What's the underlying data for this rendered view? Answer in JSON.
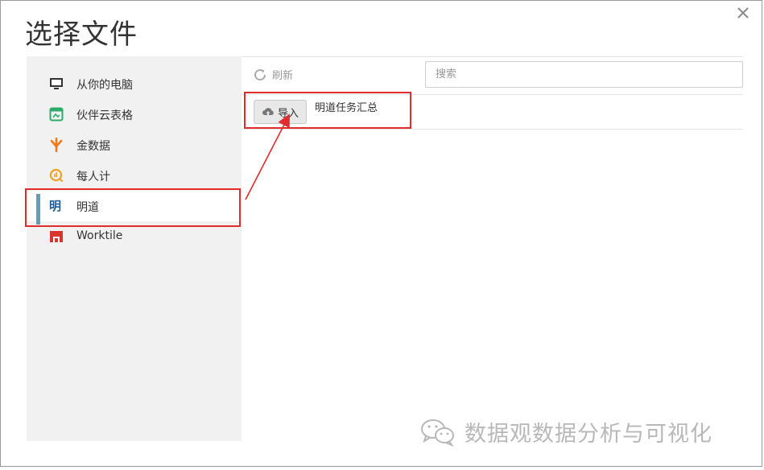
{
  "dialog": {
    "title": "选择文件"
  },
  "sidebar": {
    "items": [
      {
        "label": "从你的电脑",
        "icon": "monitor-icon"
      },
      {
        "label": "伙伴云表格",
        "icon": "spreadsheet-icon"
      },
      {
        "label": "金数据",
        "icon": "tree-logo-icon"
      },
      {
        "label": "每人计",
        "icon": "coin-logo-icon"
      },
      {
        "label": "明道",
        "icon": "mingdao-logo-icon",
        "glyph": "明"
      },
      {
        "label": "Worktile",
        "icon": "worktile-logo-icon"
      }
    ],
    "active_index": 4
  },
  "toolbar": {
    "refresh_label": "刷新",
    "search_placeholder": "搜索"
  },
  "files": [
    {
      "import_label": "导入",
      "name": "明道任务汇总"
    }
  ],
  "watermark": {
    "text": "数据观数据分析与可视化"
  },
  "colors": {
    "highlight": "#e02c2c",
    "active_bar": "#6a9ab5",
    "sidebar_bg": "#f1f1f1"
  }
}
